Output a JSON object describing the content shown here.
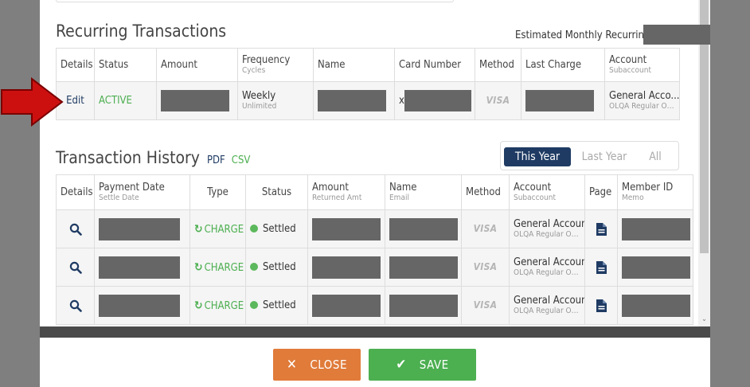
{
  "recurring": {
    "title": "Recurring Transactions",
    "estimated_label": "Estimated Monthly Recurring",
    "headers": {
      "details": "Details",
      "status": "Status",
      "amount": "Amount",
      "frequency": "Frequency",
      "frequency_sub": "Cycles",
      "name": "Name",
      "card_number": "Card Number",
      "method": "Method",
      "last_charge": "Last Charge",
      "account": "Account",
      "account_sub": "Subaccount"
    },
    "row": {
      "details": "Edit",
      "status": "ACTIVE",
      "frequency": "Weekly",
      "frequency_sub": "Unlimited",
      "card_prefix": "x",
      "method": "VISA",
      "account": "General Acco...",
      "account_sub": "OLQA Regular OF..."
    }
  },
  "history": {
    "title": "Transaction History",
    "pdf": "PDF",
    "csv": "CSV",
    "year_options": [
      "This Year",
      "Last Year",
      "All"
    ],
    "headers": {
      "details": "Details",
      "payment_date": "Payment Date",
      "payment_date_sub": "Settle Date",
      "type": "Type",
      "status": "Status",
      "amount": "Amount",
      "amount_sub": "Returned Amt",
      "name": "Name",
      "name_sub": "Email",
      "method": "Method",
      "account": "Account",
      "account_sub": "Subaccount",
      "page": "Page",
      "member_id": "Member ID",
      "member_id_sub": "Memo"
    },
    "rows": [
      {
        "type": "CHARGE",
        "status": "Settled",
        "method": "VISA",
        "account": "General Account",
        "account_sub": "OLQA Regular OF..."
      },
      {
        "type": "CHARGE",
        "status": "Settled",
        "method": "VISA",
        "account": "General Account",
        "account_sub": "OLQA Regular OF..."
      },
      {
        "type": "CHARGE",
        "status": "Settled",
        "method": "VISA",
        "account": "General Account",
        "account_sub": "OLQA Regular OF..."
      }
    ]
  },
  "footer": {
    "close_label": "CLOSE",
    "save_label": "SAVE"
  },
  "colors": {
    "navy": "#1f3b63",
    "green": "#4caf50",
    "orange": "#e07b3a",
    "arrow_red": "#cc1010"
  }
}
